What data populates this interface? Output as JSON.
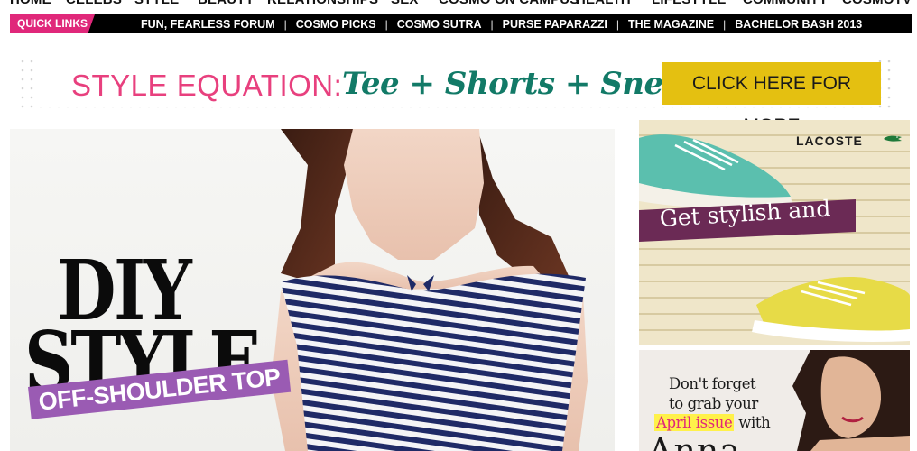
{
  "main_nav": {
    "items": [
      "HOME",
      "CELEBS",
      "STYLE",
      "BEAUTY",
      "RELATIONSHIPS",
      "SEX",
      "COSMO ON CAMPUS",
      "HEALTH",
      "LIFESTYLE",
      "COMMUNITY",
      "COSMOTV"
    ]
  },
  "quick_links": {
    "label": "QUICK LINKS",
    "items": [
      "FUN, FEARLESS FORUM",
      "COSMO PICKS",
      "COSMO SUTRA",
      "PURSE PAPARAZZI",
      "THE MAGAZINE",
      "BACHELOR BASH 2013"
    ],
    "separator": "|"
  },
  "banner": {
    "label": "STYLE EQUATION:",
    "equation": "Tee + Shorts + Sneakers",
    "cta": "CLICK HERE FOR MORE"
  },
  "hero": {
    "title_line1": "DIY",
    "title_line2": "STYLE",
    "subtitle": "OFF-SHOULDER TOP"
  },
  "ad_lacoste": {
    "brand": "LACOSTE",
    "tagline": "Get stylish and"
  },
  "ad_magazine": {
    "line1": "Don't forget",
    "line2": "to grab your",
    "highlight": "April issue",
    "line3_suffix": "with",
    "line4": "Anna"
  },
  "colors": {
    "brand_pink": "#e0287a",
    "equation_label": "#e8407e",
    "equation_items": "#127a67",
    "cta_yellow": "#e4c011",
    "subtitle_purple": "#9a5bb3"
  },
  "icons": [
    "lacoste-crocodile-icon",
    "sneaker-icon"
  ]
}
